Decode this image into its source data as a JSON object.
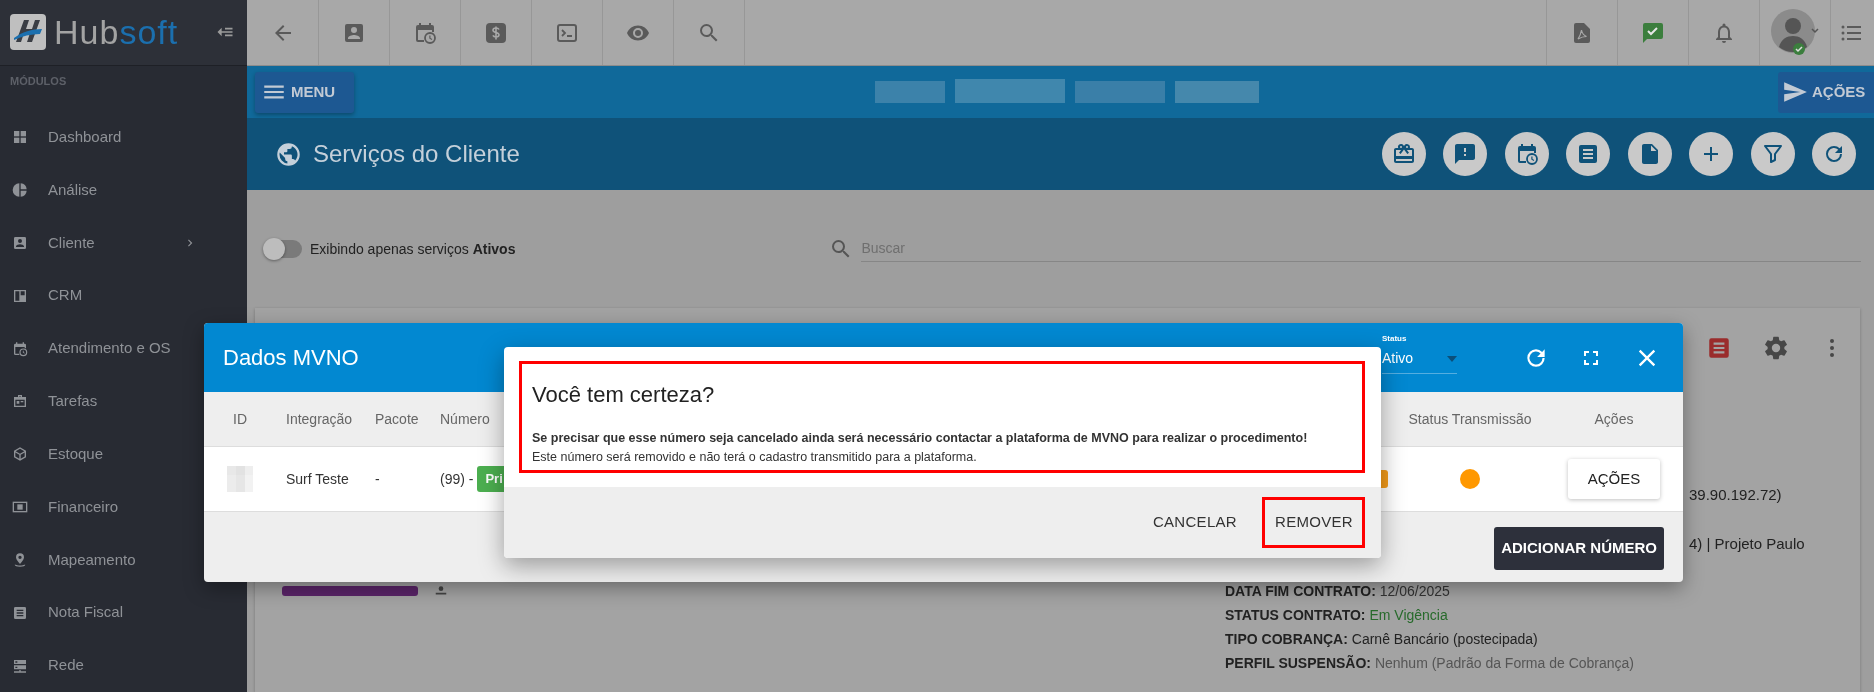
{
  "sidebar": {
    "brand_prefix": "Hub",
    "brand_suffix": "soft",
    "section_title": "MÓDULOS",
    "items": [
      {
        "label": "Dashboard",
        "expandable": false
      },
      {
        "label": "Análise",
        "expandable": false
      },
      {
        "label": "Cliente",
        "expandable": true
      },
      {
        "label": "CRM",
        "expandable": false
      },
      {
        "label": "Atendimento e OS",
        "expandable": false
      },
      {
        "label": "Tarefas",
        "expandable": false
      },
      {
        "label": "Estoque",
        "expandable": false
      },
      {
        "label": "Financeiro",
        "expandable": false
      },
      {
        "label": "Mapeamento",
        "expandable": false
      },
      {
        "label": "Nota Fiscal",
        "expandable": false
      },
      {
        "label": "Rede",
        "expandable": false
      }
    ]
  },
  "action_bar": {
    "menu_button": "MENU",
    "actions_button": "AÇÕES"
  },
  "page_title": "Serviços do Cliente",
  "filters": {
    "toggle": {
      "label": "Exibindo apenas serviços **Ativos**",
      "on": false
    },
    "search": {
      "placeholder": "Buscar"
    }
  },
  "service_card": {
    "partial_lines": [
      "39.90.192.72)",
      "4) | Projeto Paulo"
    ],
    "fields": [
      {
        "label": "DATA FIM CONTRATO:",
        "value": "12/06/2025",
        "color": "#333333"
      },
      {
        "label": "STATUS CONTRATO:",
        "value": "Em Vigência",
        "color": "#276a2b"
      },
      {
        "label": "TIPO COBRANÇA:",
        "value": "Carnê Bancário (postecipada)",
        "color": "#222222"
      },
      {
        "label": "PERFIL SUSPENSÃO:",
        "value": "Nenhum (Padrão da Forma de Cobrança)",
        "color": "#555555"
      }
    ]
  },
  "mvno_modal": {
    "title": "Dados MVNO",
    "status_filter": {
      "label": "Status",
      "value": "Ativo"
    },
    "columns": [
      "ID",
      "Integração",
      "Pacote",
      "Número",
      "Status Transmissão",
      "Ações"
    ],
    "rows": [
      {
        "integration": "Surf Teste",
        "package": "-",
        "number": "(99) -",
        "tag": "Pri",
        "color": "#ff9800",
        "action": "AÇÕES"
      }
    ],
    "add_button": "ADICIONAR NÚMERO"
  },
  "confirm_dialog": {
    "title": "Você tem certeza?",
    "warning": "Se precisar que esse número seja cancelado ainda será necessário contactar a plataforma de MVNO para realizar o procedimento!",
    "message": "Este número será removido e não terá o cadastro transmitido para a plataforma.",
    "highlighted": true,
    "buttons": [
      {
        "label": "CANCELAR",
        "highlighted": false
      },
      {
        "label": "REMOVER",
        "highlighted": true
      }
    ]
  }
}
